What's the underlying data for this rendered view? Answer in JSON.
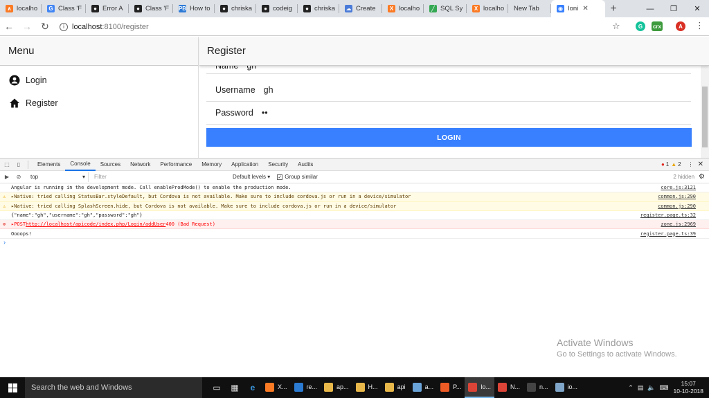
{
  "browser": {
    "tabs": [
      {
        "label": "localho",
        "icon": "xampp-icon",
        "color": "#fb7a24",
        "glyph": "∧"
      },
      {
        "label": "Class 'F",
        "icon": "google-icon",
        "color": "#4285f4",
        "glyph": "G"
      },
      {
        "label": "Error A",
        "icon": "github-icon",
        "color": "#222222",
        "glyph": "●"
      },
      {
        "label": "Class 'F",
        "icon": "github-icon",
        "color": "#222222",
        "glyph": "●"
      },
      {
        "label": "How to",
        "icon": "pb-icon",
        "color": "#2d7ad6",
        "glyph": "PB"
      },
      {
        "label": "chriska",
        "icon": "github-icon",
        "color": "#222222",
        "glyph": "●"
      },
      {
        "label": "codeig",
        "icon": "github-icon",
        "color": "#222222",
        "glyph": "●"
      },
      {
        "label": "chriska",
        "icon": "github-icon",
        "color": "#222222",
        "glyph": "●"
      },
      {
        "label": "Create",
        "icon": "cloud-icon",
        "color": "#4a7bd8",
        "glyph": "☁"
      },
      {
        "label": "localho",
        "icon": "xampp-icon",
        "color": "#fb7a24",
        "glyph": "X"
      },
      {
        "label": "SQL Sy",
        "icon": "sql-icon",
        "color": "#35a853",
        "glyph": "╱"
      },
      {
        "label": "localho",
        "icon": "xampp-icon",
        "color": "#fb7a24",
        "glyph": "X"
      },
      {
        "label": "New Tab",
        "icon": "",
        "color": "",
        "glyph": ""
      },
      {
        "label": "Ioni",
        "icon": "ionic-icon",
        "color": "#3880ff",
        "glyph": "◉",
        "active": true
      }
    ],
    "new_tab_label": "+",
    "url_host": "localhost",
    "url_path": ":8100/register"
  },
  "menu": {
    "title": "Menu",
    "items": [
      {
        "label": "Login",
        "icon": "person-icon"
      },
      {
        "label": "Register",
        "icon": "home-icon"
      }
    ]
  },
  "register": {
    "title": "Register",
    "fields": [
      {
        "label": "Name",
        "value": "gh"
      },
      {
        "label": "Username",
        "value": "gh"
      },
      {
        "label": "Password",
        "value": "••"
      }
    ],
    "button_label": "LOGIN",
    "button_color": "#3880ff"
  },
  "devtools": {
    "tabs": [
      "Elements",
      "Console",
      "Sources",
      "Network",
      "Performance",
      "Memory",
      "Application",
      "Security",
      "Audits"
    ],
    "active_tab": "Console",
    "error_count": "1",
    "warning_count": "2",
    "context": "top",
    "filter_placeholder": "Filter",
    "levels": "Default levels ▾",
    "group_similar": "Group similar",
    "hidden": "2 hidden",
    "messages": [
      {
        "type": "log",
        "text": "Angular is running in the development mode. Call enableProdMode() to enable the production mode.",
        "source": "core.js:3121"
      },
      {
        "type": "warn",
        "text": "▸Native: tried calling StatusBar.styleDefault, but Cordova is not available. Make sure to include cordova.js or run in a device/simulator",
        "source": "common.js:290"
      },
      {
        "type": "warn",
        "text": "▸Native: tried calling SplashScreen.hide, but Cordova is not available. Make sure to include cordova.js or run in a device/simulator",
        "source": "common.js:290"
      },
      {
        "type": "log",
        "text": "{\"name\":\"gh\",\"username\":\"gh\",\"password\":\"gh\"}",
        "source": "register.page.ts:32"
      },
      {
        "type": "err",
        "prefix": "▸POST ",
        "link": "http://localhost/apicode/index.php/Login/addUser",
        "suffix": " 400 (Bad Request)",
        "source": "zone.js:2969"
      },
      {
        "type": "log",
        "text": "Oooops!",
        "source": "register.page.ts:39"
      }
    ],
    "prompt": "›"
  },
  "watermark": {
    "title": "Activate Windows",
    "subtitle": "Go to Settings to activate Windows."
  },
  "taskbar": {
    "search_placeholder": "Search the web and Windows",
    "apps": [
      {
        "label": "X...",
        "icon": "xampp-icon",
        "color": "#fb7a24"
      },
      {
        "label": "re...",
        "icon": "vscode-icon",
        "color": "#2b7bd3"
      },
      {
        "label": "ap...",
        "icon": "folder-icon",
        "color": "#e8b84a"
      },
      {
        "label": "H...",
        "icon": "folder-icon",
        "color": "#e8b84a"
      },
      {
        "label": "api",
        "icon": "folder-icon",
        "color": "#e8b84a"
      },
      {
        "label": "a...",
        "icon": "box-icon",
        "color": "#6aa3d8"
      },
      {
        "label": "P...",
        "icon": "postman-icon",
        "color": "#ef5b25"
      },
      {
        "label": "lo...",
        "icon": "chrome-icon",
        "color": "#db4437",
        "active": true
      },
      {
        "label": "N...",
        "icon": "chrome-icon",
        "color": "#db4437"
      },
      {
        "label": "n...",
        "icon": "cmd-icon",
        "color": "#444444"
      },
      {
        "label": "io...",
        "icon": "notepad-icon",
        "color": "#7fa6c8"
      }
    ],
    "time": "15:07",
    "date": "10-10-2018"
  }
}
